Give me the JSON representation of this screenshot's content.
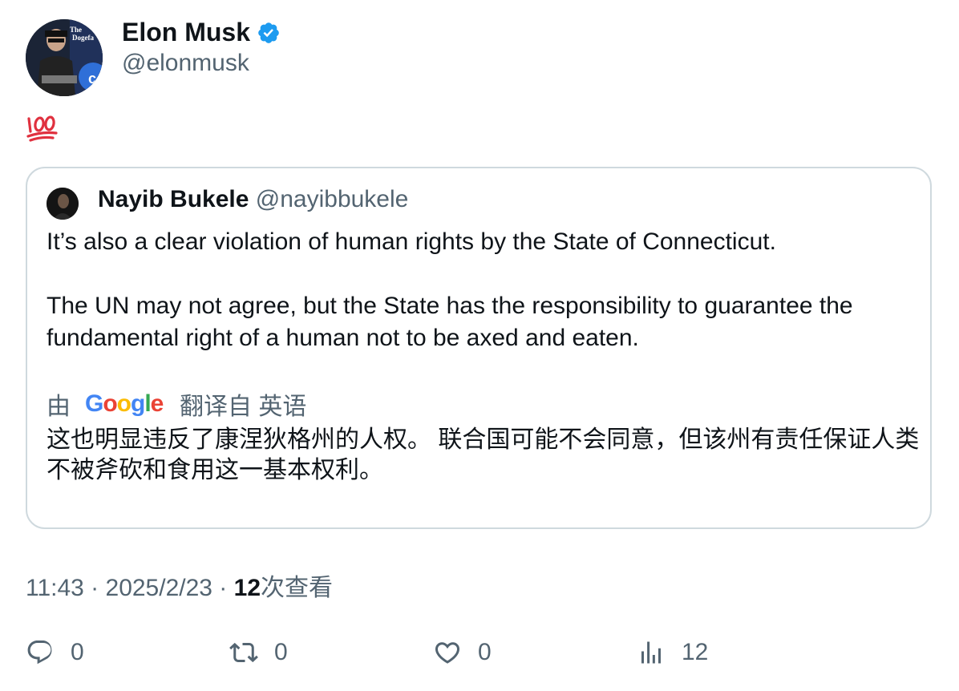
{
  "tweet": {
    "author_name": "Elon Musk",
    "author_handle": "@elonmusk",
    "verified": true,
    "body_emoji": "💯",
    "timestamp": "11:43 · 2025/2/23 · ",
    "views_count": "12",
    "views_label": "次查看"
  },
  "quote": {
    "author_name": "Nayib Bukele",
    "author_handle": "@nayibbukele",
    "paragraph1": "It’s also a clear violation of human rights by the State of Connecticut.",
    "paragraph2": "The UN may not agree, but the State has the responsibility to guarantee the fundamental right of a human not to be axed and eaten.",
    "translated_prefix": "由",
    "translated_logo_text": "Google",
    "translated_suffix": "翻译自 英语",
    "translation": "这也明显违反了康涅狄格州的人权。 联合国可能不会同意，但该州有责任保证人类不被斧砍和食用这一基本权利。"
  },
  "actions": {
    "reply_count": "0",
    "retweet_count": "0",
    "like_count": "0",
    "views_count": "12"
  },
  "colors": {
    "verified": "#1d9bf0",
    "secondary_text": "#536471",
    "border": "#cfd9de"
  },
  "icons": {
    "verified": "verified-badge-icon",
    "reply": "reply-icon",
    "retweet": "retweet-icon",
    "like": "heart-icon",
    "views": "analytics-icon"
  }
}
